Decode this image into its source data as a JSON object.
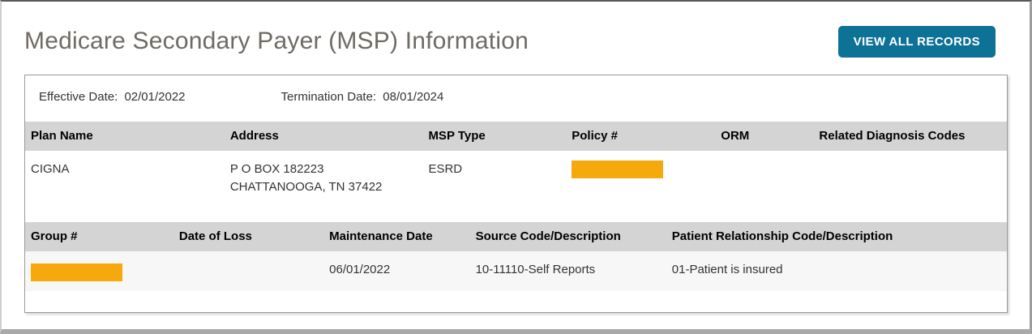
{
  "page": {
    "title": "Medicare Secondary Payer (MSP) Information",
    "view_all_button_label": "VIEW ALL RECORDS"
  },
  "dates": {
    "effective": {
      "label": "Effective Date:",
      "value": "02/01/2022"
    },
    "termination": {
      "label": "Termination Date:",
      "value": "08/01/2024"
    }
  },
  "plan_table": {
    "columns": [
      "Plan Name",
      "Address",
      "MSP Type",
      "Policy #",
      "ORM",
      "Related Diagnosis Codes"
    ],
    "row": {
      "plan_name": "CIGNA",
      "address_line1": "P O BOX 182223",
      "address_line2": "CHATTANOOGA, TN 37422",
      "msp_type": "ESRD",
      "policy_number_redacted": true,
      "orm": "",
      "related_diagnosis_codes": ""
    }
  },
  "detail_table": {
    "columns": [
      "Group #",
      "Date of Loss",
      "Maintenance Date",
      "Source Code/Description",
      "Patient Relationship Code/Description"
    ],
    "row": {
      "group_number_redacted": true,
      "date_of_loss": "",
      "maintenance_date": "06/01/2022",
      "source_code_description": "10-11110-Self Reports",
      "patient_relationship_code_description": "01-Patient is insured"
    }
  },
  "colors": {
    "button_background": "#0e7296",
    "redaction_highlight": "#f5a90c",
    "table_header_background": "#d4d4d4",
    "detail_row_background": "#f7f7f7",
    "title_text": "#6f6a64",
    "body_text": "#333333"
  }
}
